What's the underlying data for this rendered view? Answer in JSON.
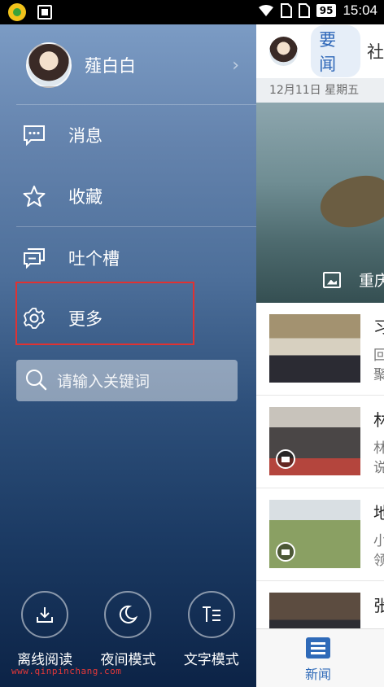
{
  "status_bar": {
    "battery": "95",
    "time": "15:04",
    "icons": [
      "app-logo-icon",
      "scan-icon",
      "wifi-icon",
      "sim-card-icon",
      "sim-card-icon",
      "battery-icon"
    ]
  },
  "drawer": {
    "profile": {
      "name": "薤白白",
      "avatar_icon": "avatar-icon",
      "chevron": "›"
    },
    "menu": [
      {
        "label": "消息",
        "icon": "message-icon"
      },
      {
        "label": "收藏",
        "icon": "star-icon"
      },
      {
        "label": "吐个槽",
        "icon": "feedback-icon"
      },
      {
        "label": "更多",
        "icon": "gear-icon"
      }
    ],
    "search": {
      "placeholder": "请输入关键词",
      "icon": "search-icon"
    },
    "bottom_actions": [
      {
        "label": "离线阅读",
        "icon": "download-icon"
      },
      {
        "label": "夜间模式",
        "icon": "moon-icon"
      },
      {
        "label": "文字模式",
        "icon": "text-mode-icon"
      }
    ],
    "watermark": "www.qinpinchang.com",
    "highlight_color": "#e03232"
  },
  "main": {
    "tabs": [
      {
        "label": "要闻",
        "active": true
      },
      {
        "label": "社",
        "active": false
      }
    ],
    "date": "12月11日 星期五",
    "hero_caption": "重庆",
    "news": [
      {
        "title": "习",
        "line1": "回",
        "line2": "聚",
        "video": false
      },
      {
        "title": "林",
        "line1": "林",
        "line2": "说",
        "video": true
      },
      {
        "title": "地",
        "line1": "小",
        "line2": "领",
        "video": true
      },
      {
        "title": "张",
        "line1": "",
        "line2": "",
        "video": false
      }
    ],
    "bottom_nav": {
      "label": "新闻",
      "icon": "news-icon"
    },
    "accent_color": "#2f6ab8"
  }
}
